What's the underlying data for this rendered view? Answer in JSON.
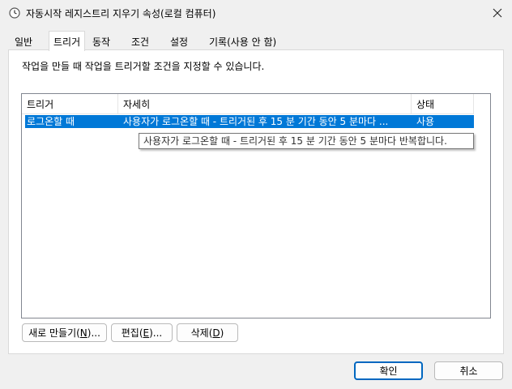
{
  "window": {
    "title": "자동시작 레지스트리 지우기 속성(로컬 컴퓨터)",
    "icon": "clock-icon"
  },
  "tabs": [
    {
      "label": "일반"
    },
    {
      "label": "트리거",
      "active": true
    },
    {
      "label": "동작"
    },
    {
      "label": "조건"
    },
    {
      "label": "설정"
    },
    {
      "label": "기록(사용 안 함)"
    }
  ],
  "description": "작업을 만들 때 작업을 트리거할 조건을 지정할 수 있습니다.",
  "trigger_list": {
    "columns": [
      "트리거",
      "자세히",
      "상태"
    ],
    "rows": [
      {
        "trigger": "로그온할 때",
        "details": "사용자가 로그온할 때 - 트리거된 후 15 분 기간 동안 5 분마다 ...",
        "status": "사용",
        "selected": true
      }
    ],
    "tooltip": "사용자가 로그온할 때 - 트리거된 후 15 분 기간 동안 5 분마다 반복합니다."
  },
  "actions": {
    "new_prefix": "새로 만들기(",
    "new_key": "N",
    "new_suffix": ")...",
    "edit_prefix": "편집(",
    "edit_key": "E",
    "edit_suffix": ")...",
    "delete_prefix": "삭제(",
    "delete_key": "D",
    "delete_suffix": ")"
  },
  "footer": {
    "ok": "확인",
    "cancel": "취소"
  },
  "colors": {
    "selection": "#0078d7",
    "default_button_border": "#0067c0"
  }
}
